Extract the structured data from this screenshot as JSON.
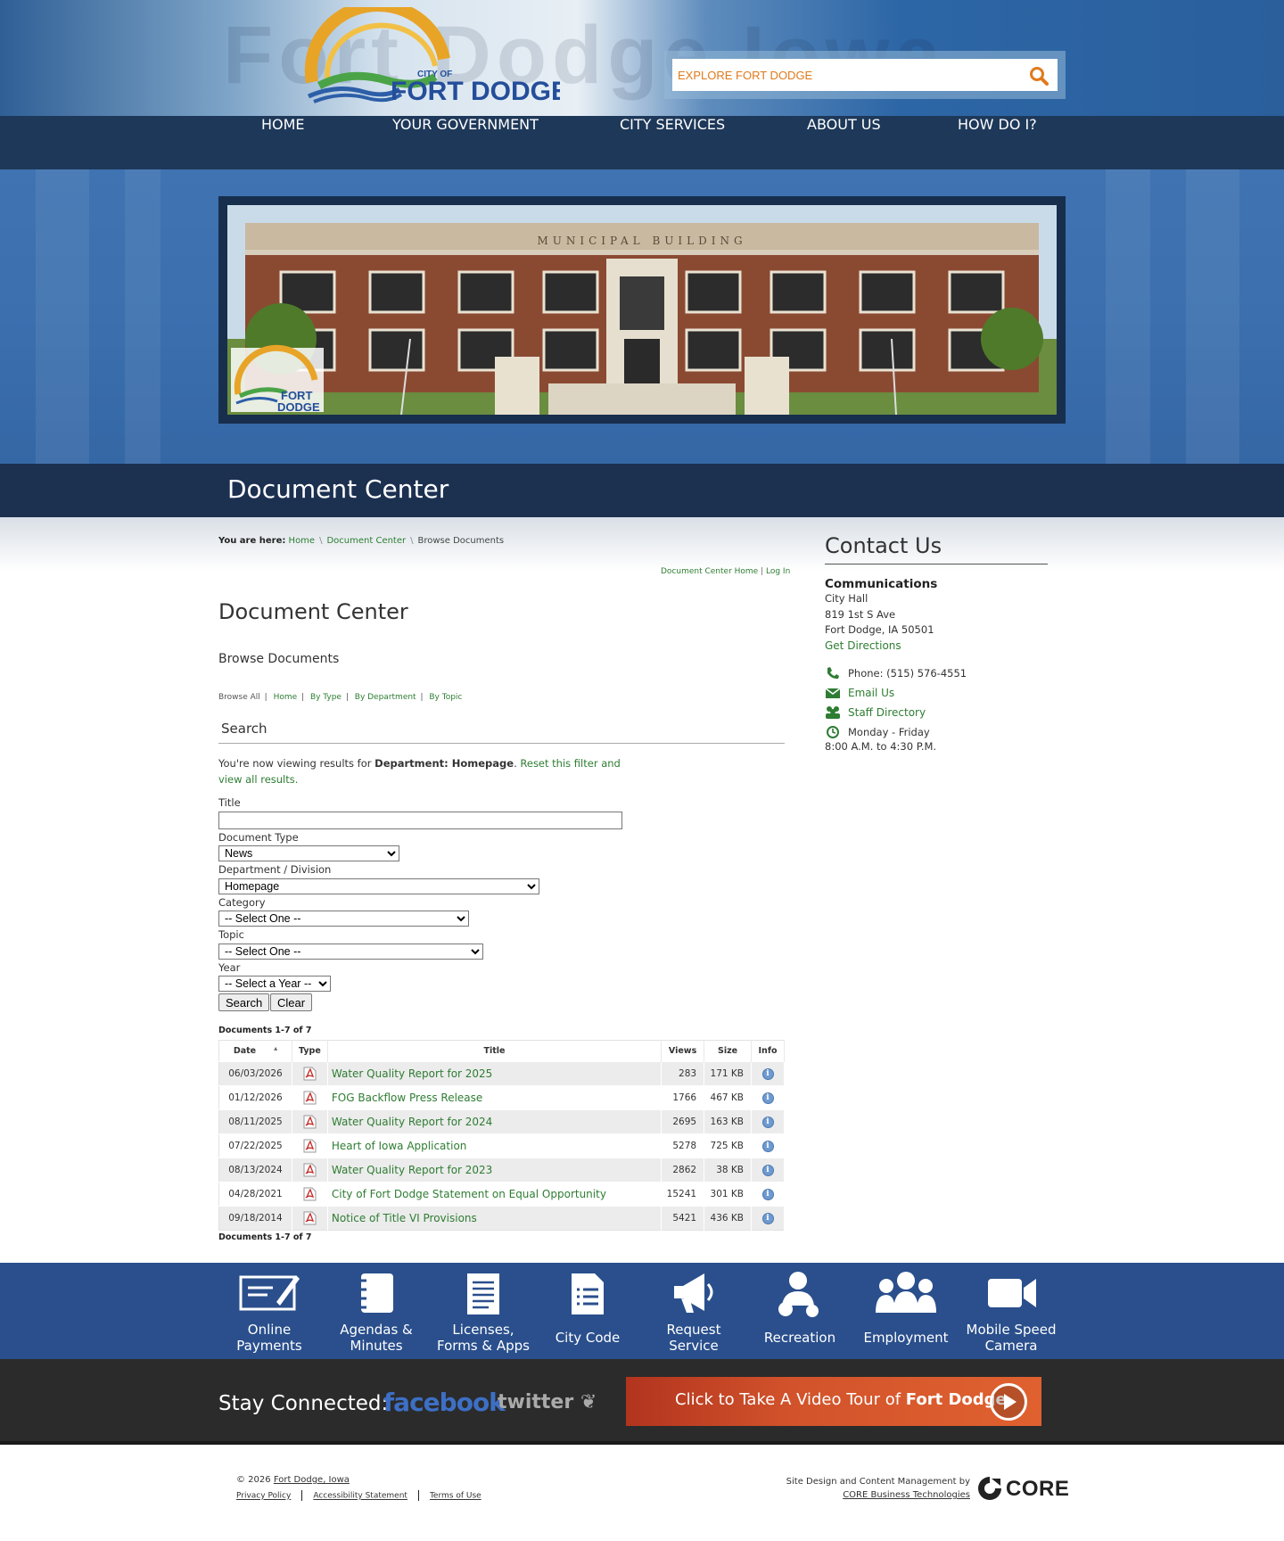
{
  "header": {
    "logo_small": "CITY OF",
    "logo_big": "FORT DODGE",
    "watermark": "Fort Dodge Iowa",
    "search_placeholder": "EXPLORE FORT DODGE",
    "accent": "#e07a1c"
  },
  "nav": [
    "HOME",
    "YOUR GOVERNMENT",
    "CITY SERVICES",
    "ABOUT US",
    "HOW DO I?"
  ],
  "banner": {
    "building_inscription": "MUNICIPAL BUILDING",
    "logo_small": "FORT",
    "logo_big": "DODGE"
  },
  "title_bar": "Document Center",
  "breadcrumb": {
    "prefix": "You are here:",
    "items": [
      "Home",
      "Document Center"
    ],
    "current": "Browse Documents"
  },
  "dc_links": [
    "Document Center Home",
    "Log In"
  ],
  "main": {
    "heading": "Document Center",
    "subheading": "Browse Documents",
    "browse_prefix": "Browse All",
    "browse_links": [
      "Home",
      "By Type",
      "By Department",
      "By Topic"
    ],
    "search_heading": "Search",
    "filter_note_prefix": "You're now viewing results for ",
    "filter_note_bold": "Department: Homepage",
    "filter_note_link": "Reset this filter and view all results."
  },
  "form": {
    "title_label": "Title",
    "doc_type_label": "Document Type",
    "doc_type_value": "News",
    "dept_label": "Department / Division",
    "dept_value": "Homepage",
    "category_label": "Category",
    "category_value": "-- Select One --",
    "topic_label": "Topic",
    "topic_value": "-- Select One --",
    "year_label": "Year",
    "year_value": "-- Select a Year --",
    "search_btn": "Search",
    "clear_btn": "Clear"
  },
  "table": {
    "count_label": "Documents 1-7 of 7",
    "headers": [
      "Date",
      "Type",
      "Title",
      "Views",
      "Size",
      "Info"
    ],
    "rows": [
      {
        "date": "06/03/2026",
        "title": "Water Quality Report for 2025",
        "views": "283",
        "size": "171 KB"
      },
      {
        "date": "01/12/2026",
        "title": "FOG Backflow Press Release",
        "views": "1766",
        "size": "467 KB"
      },
      {
        "date": "08/11/2025",
        "title": "Water Quality Report for 2024",
        "views": "2695",
        "size": "163 KB"
      },
      {
        "date": "07/22/2025",
        "title": "Heart of Iowa Application",
        "views": "5278",
        "size": "725 KB"
      },
      {
        "date": "08/13/2024",
        "title": "Water Quality Report for 2023",
        "views": "2862",
        "size": "38 KB"
      },
      {
        "date": "04/28/2021",
        "title": "City of Fort Dodge Statement on Equal Opportunity",
        "views": "15241",
        "size": "301 KB"
      },
      {
        "date": "09/18/2014",
        "title": "Notice of Title VI Provisions",
        "views": "5421",
        "size": "436 KB"
      }
    ]
  },
  "contact": {
    "heading": "Contact Us",
    "dept": "Communications",
    "building": "City Hall",
    "address1": "819 1st S Ave",
    "address2": "Fort Dodge, IA 50501",
    "directions": "Get Directions",
    "phone": "Phone: (515) 576-4551",
    "email": "Email Us",
    "staff": "Staff Directory",
    "hours1": "Monday - Friday",
    "hours2": "8:00 A.M. to 4:30 P.M."
  },
  "quick_links": [
    {
      "line1": "Online",
      "line2": "Payments",
      "icon": "check-icon"
    },
    {
      "line1": "Agendas &",
      "line2": "Minutes",
      "icon": "notebook-icon"
    },
    {
      "line1": "Licenses,",
      "line2": "Forms & Apps",
      "icon": "form-icon"
    },
    {
      "line1": "City Code",
      "line2": "",
      "icon": "document-icon"
    },
    {
      "line1": "Request",
      "line2": "Service",
      "icon": "megaphone-icon"
    },
    {
      "line1": "Recreation",
      "line2": "",
      "icon": "recreation-icon"
    },
    {
      "line1": "Employment",
      "line2": "",
      "icon": "people-icon"
    },
    {
      "line1": "Mobile Speed",
      "line2": "Camera",
      "icon": "video-camera-icon"
    }
  ],
  "stay_connected": {
    "label": "Stay Connected:",
    "facebook": "facebook",
    "twitter": "twitter",
    "tour_prefix": "Click to Take A Video Tour of ",
    "tour_bold": "Fort Dodge"
  },
  "footer": {
    "copyright_prefix": "© 2026 ",
    "copyright_link": "Fort Dodge, Iowa",
    "links": [
      "Privacy Policy",
      "Accessibility Statement",
      "Terms of Use"
    ],
    "credit_text": "Site Design and Content Management by",
    "credit_link": "CORE Business Technologies",
    "core_logo": "CORE"
  }
}
